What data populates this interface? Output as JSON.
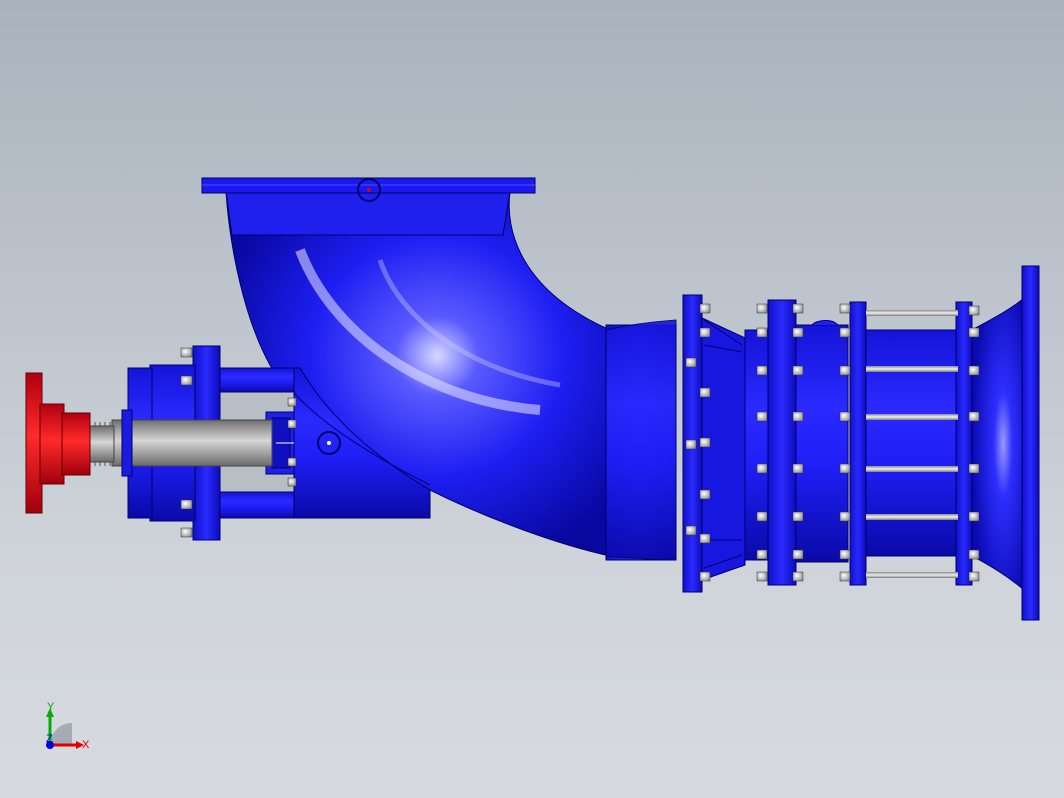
{
  "scene": {
    "subject": "axial-flow-pump-assembly",
    "colors": {
      "body_blue": "#1a1aff",
      "body_dark": "#0000b4",
      "body_light": "#8a8aff",
      "coupling_red": "#e3141e",
      "shaft_gray": "#9a9a9a"
    }
  },
  "triad": {
    "x_label": "X",
    "y_label": "Y",
    "z_label": "Z",
    "x_color": "#e00000",
    "y_color": "#00b000",
    "z_color": "#0000e0"
  }
}
